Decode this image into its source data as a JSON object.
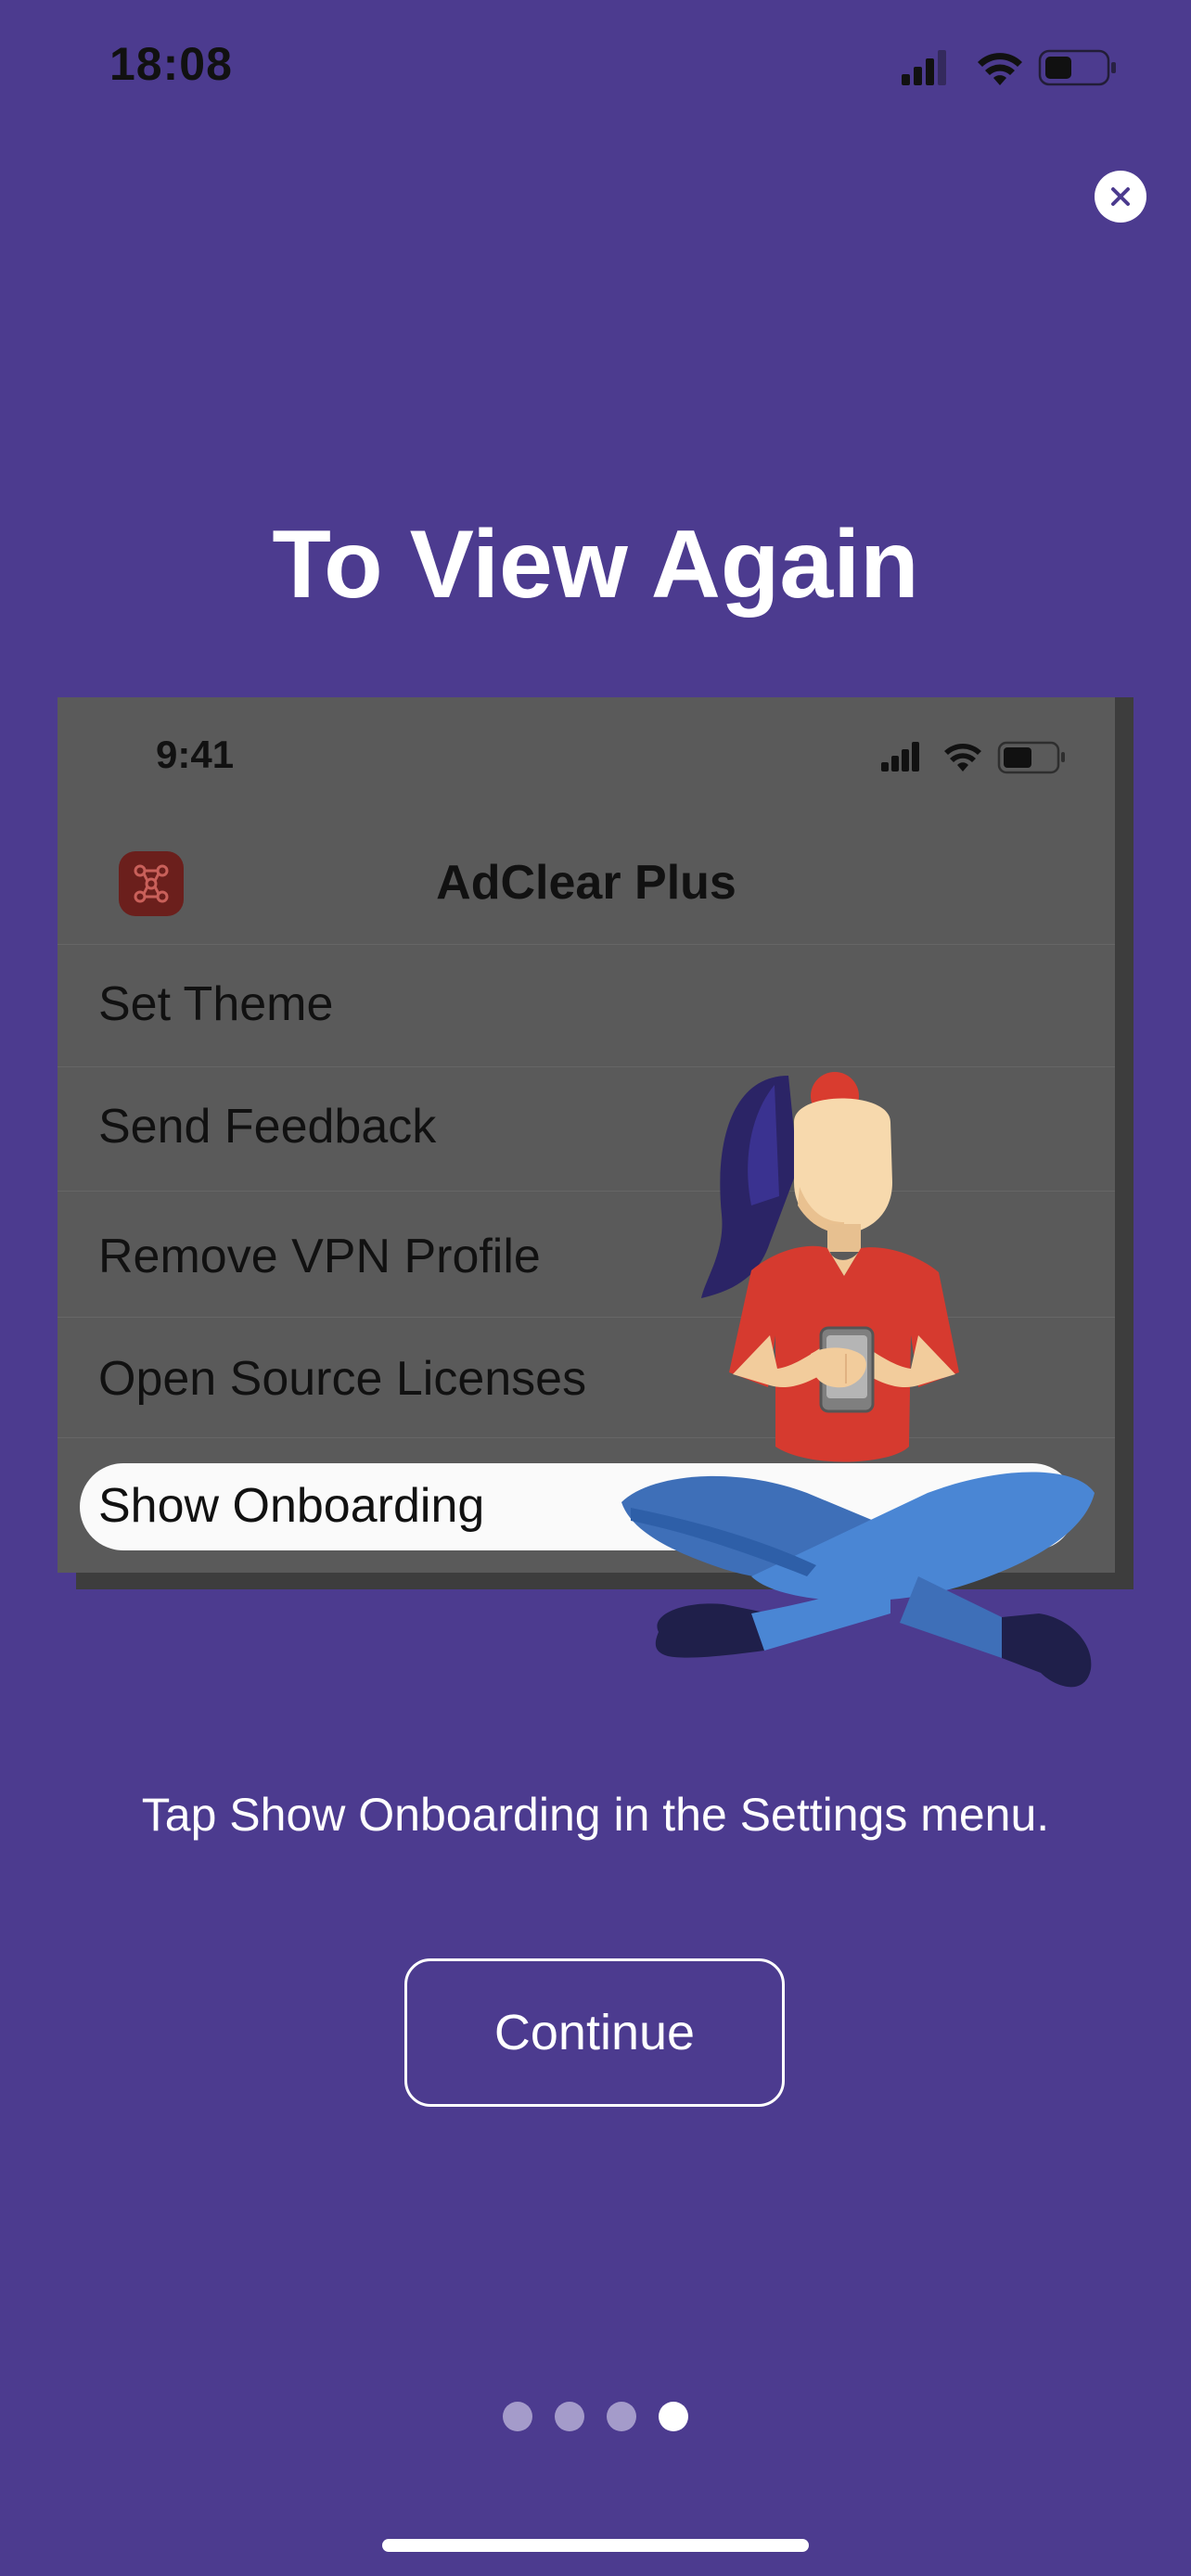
{
  "status_bar": {
    "time": "18:08"
  },
  "title": "To View Again",
  "preview": {
    "time": "9:41",
    "app_title": "AdClear Plus",
    "menu_items": [
      "Set Theme",
      "Send Feedback",
      "Remove VPN Profile",
      "Open Source Licenses",
      "Show Onboarding"
    ],
    "highlighted_item": "Show Onboarding"
  },
  "instruction": "Tap Show Onboarding in the Settings menu.",
  "continue_label": "Continue",
  "pager": {
    "total": 4,
    "current": 4
  },
  "colors": {
    "background": "#4c3b8f",
    "preview_background": "#5a5a5a",
    "logo": "#6b1f1c"
  },
  "icons": {
    "close": "close-icon",
    "signal": "cellular-signal-icon",
    "wifi": "wifi-icon",
    "battery": "battery-icon",
    "app_logo": "network-nodes-icon"
  }
}
